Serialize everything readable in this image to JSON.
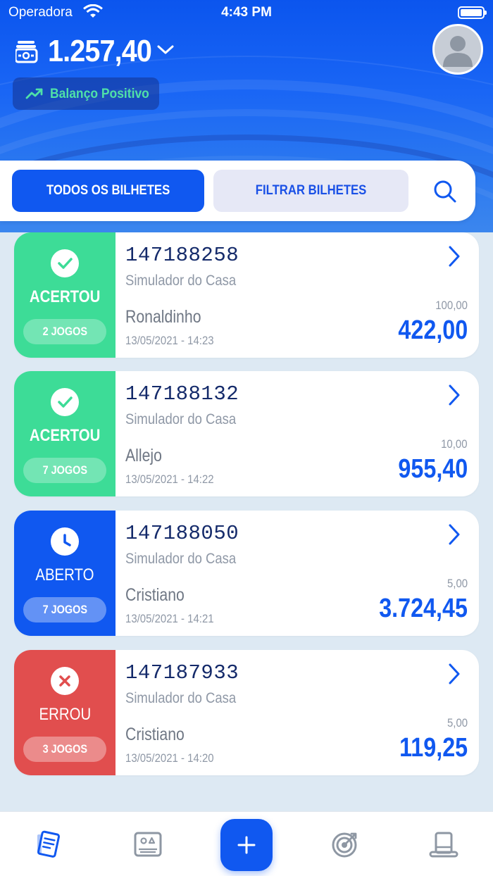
{
  "status_bar": {
    "carrier": "Operadora",
    "time": "4:43 PM"
  },
  "header": {
    "balance": "1.257,40",
    "balance_status": "Balanço Positivo"
  },
  "tabs": {
    "all_label": "TODOS OS BILHETES",
    "filter_label": "FILTRAR BILHETES"
  },
  "colors": {
    "primary": "#1058f0",
    "won": "#3ddc97",
    "lost": "#e14e4e",
    "positive_text": "#4fe0a8"
  },
  "tickets": [
    {
      "status": "ACERTOU",
      "status_type": "won",
      "games": "2 JOGOS",
      "id": "147188258",
      "source": "Simulador do Casa",
      "name": "Ronaldinho",
      "date": "13/05/2021 - 14:23",
      "stake": "100,00",
      "return": "422,00"
    },
    {
      "status": "ACERTOU",
      "status_type": "won",
      "games": "7 JOGOS",
      "id": "147188132",
      "source": "Simulador do Casa",
      "name": "Allejo",
      "date": "13/05/2021 - 14:22",
      "stake": "10,00",
      "return": "955,40"
    },
    {
      "status": "ABERTO",
      "status_type": "open",
      "games": "7 JOGOS",
      "id": "147188050",
      "source": "Simulador do Casa",
      "name": "Cristiano",
      "date": "13/05/2021 - 14:21",
      "stake": "5,00",
      "return": "3.724,45"
    },
    {
      "status": "ERROU",
      "status_type": "lost",
      "games": "3 JOGOS",
      "id": "147187933",
      "source": "Simulador do Casa",
      "name": "Cristiano",
      "date": "13/05/2021 - 14:20",
      "stake": "5,00",
      "return": "119,25"
    }
  ],
  "bottom_nav": [
    "tickets-icon",
    "game-card-icon",
    "add-icon",
    "target-icon",
    "top-hat-icon"
  ]
}
